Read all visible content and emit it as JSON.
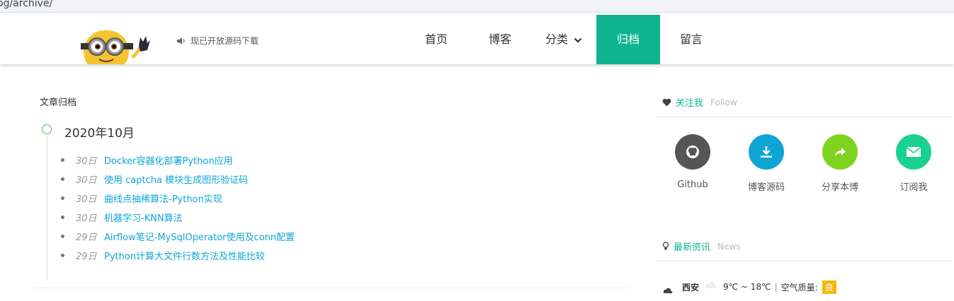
{
  "browser": {
    "url_fragment": "og/archive/"
  },
  "header": {
    "notice": "现已开放源码下载",
    "nav": [
      {
        "label": "首页"
      },
      {
        "label": "博客"
      },
      {
        "label": "分类"
      },
      {
        "label": "归档"
      },
      {
        "label": "留言"
      }
    ],
    "active_color": "#10b491"
  },
  "archive": {
    "section_title": "文章归档",
    "month": "2020年10月",
    "posts": [
      {
        "day": "30日",
        "title": "Docker容器化部署Python应用"
      },
      {
        "day": "30日",
        "title": "使用 captcha 模块生成图形验证码"
      },
      {
        "day": "30日",
        "title": "曲线点抽稀算法-Python实现"
      },
      {
        "day": "30日",
        "title": "机器学习-KNN算法"
      },
      {
        "day": "29日",
        "title": "Airflow笔记-MySqlOperator使用及conn配置"
      },
      {
        "day": "29日",
        "title": "Python计算大文件行数方法及性能比较"
      }
    ]
  },
  "sidebar": {
    "follow": {
      "title": "关注我",
      "subtitle": "Follow",
      "items": [
        {
          "label": "Github",
          "icon": "github-icon",
          "color": "#555555"
        },
        {
          "label": "博客源码",
          "icon": "download-icon",
          "color": "#0ea5d4"
        },
        {
          "label": "分享本博",
          "icon": "share-icon",
          "color": "#7ed321"
        },
        {
          "label": "订阅我",
          "icon": "mail-icon",
          "color": "#19d28f"
        }
      ]
    },
    "news": {
      "title": "最新资讯",
      "subtitle": "News",
      "city": "西安",
      "temp": "9℃ ~ 18℃",
      "separator": "|",
      "air_label": "空气质量:",
      "air_value": "良"
    }
  }
}
